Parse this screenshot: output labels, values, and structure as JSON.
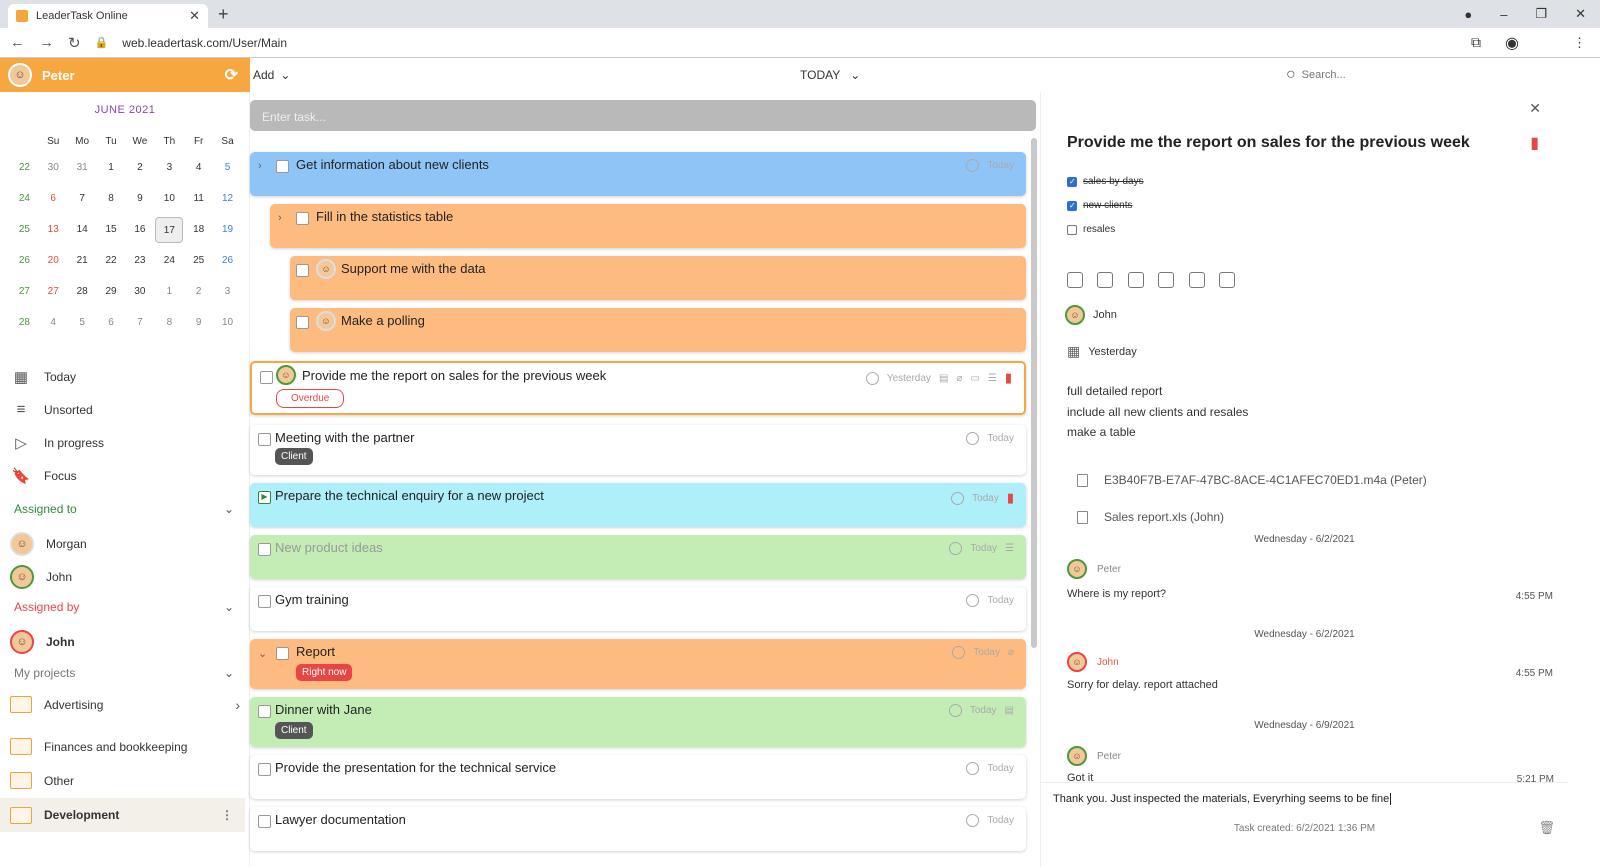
{
  "browser": {
    "tab_title": "LeaderTask Online",
    "url": "web.leadertask.com/User/Main"
  },
  "user": {
    "name": "Peter"
  },
  "calendar": {
    "month": "JUNE 2021",
    "weekdays": [
      "Su",
      "Mo",
      "Tu",
      "We",
      "Th",
      "Fr",
      "Sa"
    ],
    "weeks": [
      {
        "wk": "22",
        "days": [
          "30",
          "31",
          "1",
          "2",
          "3",
          "4",
          "5"
        ]
      },
      {
        "wk": "24",
        "days": [
          "6",
          "7",
          "8",
          "9",
          "10",
          "11",
          "12"
        ]
      },
      {
        "wk": "25",
        "days": [
          "13",
          "14",
          "15",
          "16",
          "17",
          "18",
          "19"
        ]
      },
      {
        "wk": "26",
        "days": [
          "20",
          "21",
          "22",
          "23",
          "24",
          "25",
          "26"
        ]
      },
      {
        "wk": "27",
        "days": [
          "27",
          "28",
          "29",
          "30",
          "1",
          "2",
          "3"
        ]
      },
      {
        "wk": "28",
        "days": [
          "4",
          "5",
          "6",
          "7",
          "8",
          "9",
          "10"
        ]
      }
    ],
    "selected": "17"
  },
  "nav": {
    "today": "Today",
    "unsorted": "Unsorted",
    "in_progress": "In progress",
    "focus": "Focus",
    "assigned_to": "Assigned to",
    "assigned_to_people": [
      "Morgan",
      "John"
    ],
    "assigned_by": "Assigned by",
    "assigned_by_people": [
      "John"
    ],
    "my_projects": "My projects",
    "projects": [
      "Advertising",
      "Finances and bookkeeping",
      "Other",
      "Development"
    ]
  },
  "toolbar": {
    "add": "Add",
    "period": "TODAY",
    "search_placeholder": "Search..."
  },
  "task_input_placeholder": "Enter task...",
  "tasks": [
    {
      "title": "Get information about new clients",
      "date": "Today"
    },
    {
      "title": "Fill in the statistics table"
    },
    {
      "title": "Support me with the data"
    },
    {
      "title": "Make a polling"
    },
    {
      "title": "Provide me the report on sales for the previous week",
      "date": "Yesterday",
      "badge": "Overdue"
    },
    {
      "title": "Meeting with the partner",
      "date": "Today",
      "badge": "Client"
    },
    {
      "title": "Prepare the technical enquiry for a new project",
      "date": "Today"
    },
    {
      "title": "New product ideas",
      "date": "Today"
    },
    {
      "title": "Gym training",
      "date": "Today"
    },
    {
      "title": "Report",
      "date": "Today",
      "badge": "Right now"
    },
    {
      "title": "Dinner with Jane",
      "date": "Today",
      "badge": "Client"
    },
    {
      "title": "Provide the presentation for the technical service",
      "date": "Today"
    },
    {
      "title": "Lawyer documentation",
      "date": "Today"
    }
  ],
  "detail": {
    "title": "Provide me the report on sales for the previous week",
    "checklist": [
      {
        "label": "sales by days",
        "done": true
      },
      {
        "label": "new clients",
        "done": true
      },
      {
        "label": "resales",
        "done": false
      }
    ],
    "assignee": "John",
    "due": "Yesterday",
    "description": [
      "full detailed report",
      "include all new clients and resales",
      "make a table"
    ],
    "attachments": [
      "E3B40F7B-E7AF-47BC-8ACE-4C1AFEC70ED1.m4a (Peter)",
      "Sales report.xls (John)"
    ],
    "messages": [
      {
        "date": "Wednesday - 6/2/2021",
        "author": "Peter",
        "text": "Where is my report?",
        "time": "4:55 PM"
      },
      {
        "date": "Wednesday - 6/2/2021",
        "author": "John",
        "text": "Sorry for delay. report attached",
        "time": "4:55 PM"
      },
      {
        "date": "Wednesday - 6/9/2021",
        "author": "Peter",
        "text": "Got it",
        "time": "5:21 PM"
      }
    ],
    "reply": "Thank you. Just inspected the materials, Everyrhing seems to be fine",
    "created": "Task created: 6/2/2021 1:36 PM"
  },
  "colors": {
    "orange": "#f6a740",
    "blue": "#8fc4f7",
    "peach": "#fdbb80",
    "cyan": "#aeeffa",
    "green": "#c3edb5",
    "red": "#e84545"
  }
}
